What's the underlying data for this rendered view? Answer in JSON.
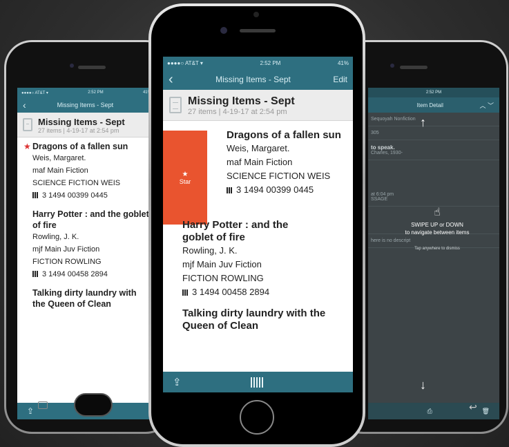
{
  "list": {
    "title": "Missing Items - Sept",
    "count": "27 items",
    "separator": "|",
    "date": "4-19-17 at 2:54 pm",
    "back_label": "‹",
    "edit_label": "Edit"
  },
  "status": {
    "carrier": "●●●●○ AT&T ▾",
    "time": "2:52 PM",
    "battery": "41%"
  },
  "items": [
    {
      "title": "Dragons of a fallen sun",
      "author": "Weis, Margaret.",
      "location": "maf Main Fiction",
      "call": "SCIENCE FICTION WEIS",
      "barcode": "3 1494 00399 0445"
    },
    {
      "title": "Harry Potter : and the goblet of fire",
      "author": "Rowling, J. K.",
      "location": "mjf Main Juv Fiction",
      "call": "FICTION ROWLING",
      "barcode": "3 1494 00458 2894"
    },
    {
      "title": "Talking dirty laundry with the Queen of Clean",
      "author": "",
      "location": "",
      "call": "",
      "barcode": ""
    }
  ],
  "swipe_action": {
    "icon": "star-icon",
    "label": "Star"
  },
  "toolbar": {
    "share_icon": "share-icon",
    "scan_icon": "barcode-scan-icon"
  },
  "detail": {
    "title": "Item Detail",
    "rows": [
      "Sequoyah Nonfiction",
      "305",
      "to speak.",
      "Charles, 1930-",
      "",
      "at 6:04 pm",
      "SSAGE",
      "",
      "here is no descript"
    ],
    "swipe_text_1": "SWIPE UP or DOWN",
    "swipe_text_2": "to navigate between items",
    "dismiss_text": "Tap anywhere to dismiss"
  },
  "colors": {
    "accent": "#2e6f80",
    "swipe_star": "#e9542f",
    "star": "#dd3333"
  }
}
